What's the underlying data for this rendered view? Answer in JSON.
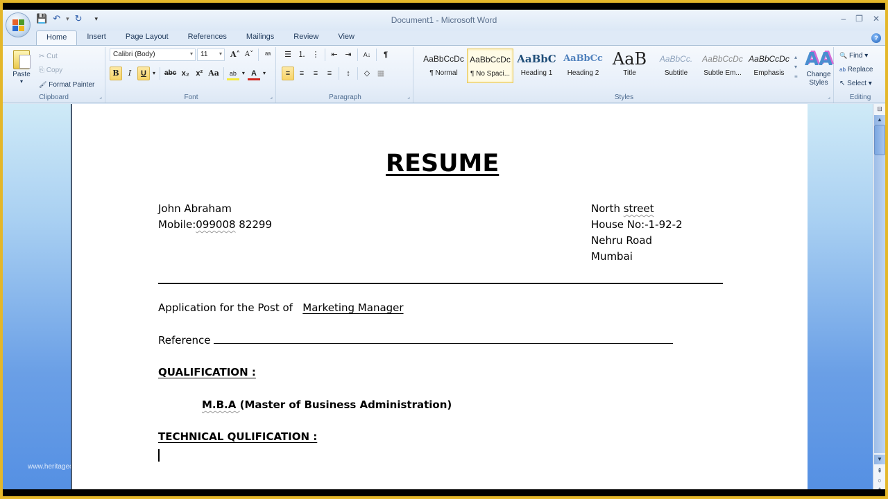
{
  "window": {
    "title": "Document1 - Microsoft Word",
    "controls": {
      "minimize": "–",
      "restore": "❐",
      "close": "✕"
    }
  },
  "quick_access": {
    "save_icon": "💾",
    "undo_icon": "↶",
    "undo_dropdown": "▾",
    "redo_icon": "↻",
    "customize_icon": "▾"
  },
  "tabs": [
    {
      "label": "Home",
      "active": true
    },
    {
      "label": "Insert"
    },
    {
      "label": "Page Layout"
    },
    {
      "label": "References"
    },
    {
      "label": "Mailings"
    },
    {
      "label": "Review"
    },
    {
      "label": "View"
    }
  ],
  "help_label": "?",
  "ribbon": {
    "clipboard": {
      "label": "Clipboard",
      "paste": "Paste",
      "paste_dropdown": "▾",
      "cut": "Cut",
      "copy": "Copy",
      "format_painter": "Format Painter",
      "cut_icon": "✂",
      "copy_icon": "⎘",
      "painter_icon": "🖌"
    },
    "font": {
      "label": "Font",
      "font_name": "Calibri (Body)",
      "font_size": "11",
      "grow": "A˄",
      "shrink": "A˅",
      "clear": "ᵃᵃ",
      "bold": "B",
      "italic": "I",
      "underline": "U",
      "strike": "abc",
      "subscript": "x₂",
      "superscript": "x²",
      "change_case": "Aa",
      "highlight": "ab",
      "font_color": "A"
    },
    "paragraph": {
      "label": "Paragraph",
      "bullets": "☰",
      "numbering": "⒈",
      "multilevel": "⋮",
      "decrease_indent": "⇤",
      "increase_indent": "⇥",
      "sort": "A↓",
      "pilcrow": "¶",
      "align_left": "≡",
      "center": "≡",
      "align_right": "≡",
      "justify": "≡",
      "line_spacing": "↕",
      "shading": "◇",
      "borders": "▦"
    },
    "styles": {
      "label": "Styles",
      "items": [
        {
          "sample": "AaBbCcDc",
          "name": "¶ Normal"
        },
        {
          "sample": "AaBbCcDc",
          "name": "¶ No Spaci...",
          "active": true
        },
        {
          "sample": "AaBbC",
          "name": "Heading 1"
        },
        {
          "sample": "AaBbCc",
          "name": "Heading 2"
        },
        {
          "sample": "AaB",
          "name": "Title"
        },
        {
          "sample": "AaBbCc.",
          "name": "Subtitle"
        },
        {
          "sample": "AaBbCcDc",
          "name": "Subtle Em..."
        },
        {
          "sample": "AaBbCcDc",
          "name": "Emphasis"
        }
      ],
      "change_styles": "Change Styles",
      "change_styles_icon": "AA"
    },
    "editing": {
      "label": "Editing",
      "find": "Find ▾",
      "replace": "Replace",
      "select": "Select ▾",
      "find_icon": "🔍",
      "replace_icon": "ab",
      "select_icon": "↖"
    }
  },
  "document": {
    "title": "RESUME",
    "name": "John Abraham",
    "mobile_label": "Mobile:",
    "mobile_number_part1": "099008",
    "mobile_number_part2": " 82299",
    "address": {
      "line1_a": "North ",
      "line1_b": "street",
      "line2": "House No:-1-92-2",
      "line3": "Nehru Road",
      "line4": "Mumbai"
    },
    "application_label": "Application for the Post of",
    "application_value": "Marketing Manager",
    "reference_label": "Reference",
    "qualification_heading": "QUALIFICATION  :",
    "qualification_abbr": "M.B.A ",
    "qualification_full": " (Master of Business Administration)",
    "technical_heading": "TECHNICAL QULIFICATION  :"
  },
  "watermark": "www.heritagechristiancollege.com",
  "scrollbar": {
    "ruler_icon": "⊟",
    "up": "▲",
    "down": "▼",
    "prev_page": "⇞",
    "select_browse": "○",
    "next_page": "⇟"
  }
}
